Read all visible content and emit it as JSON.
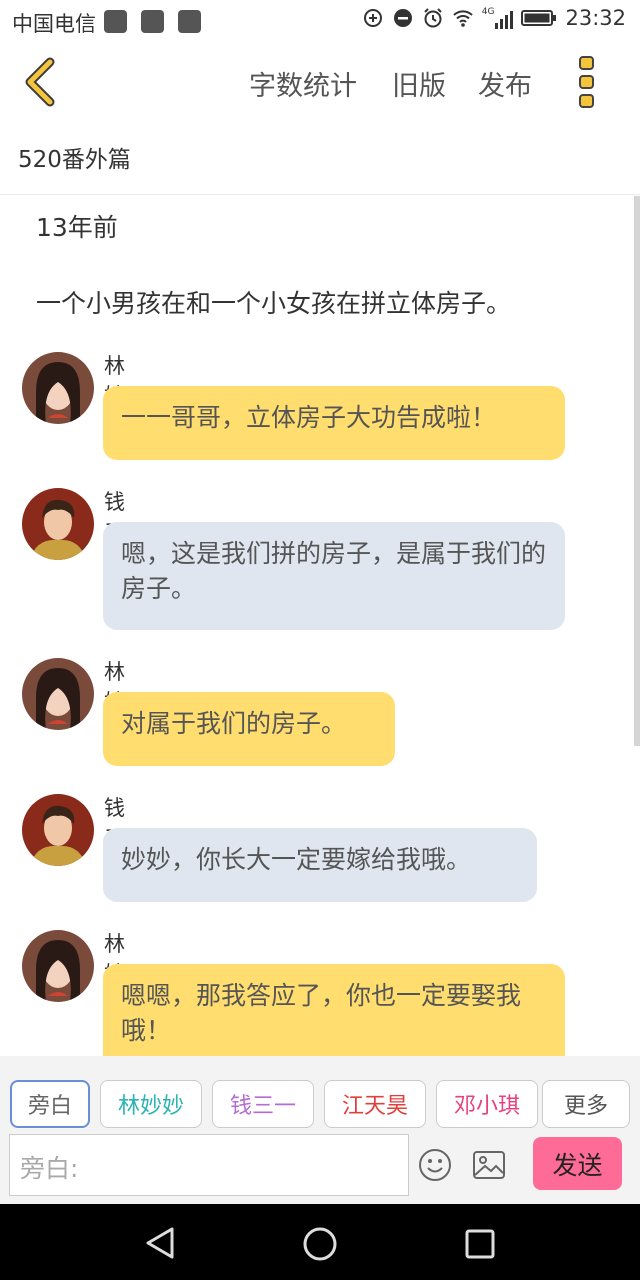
{
  "status_bar": {
    "carrier": "中国电信",
    "network": "4G",
    "time": "23:32"
  },
  "header": {
    "word_count": "字数统计",
    "old_version": "旧版",
    "publish": "发布"
  },
  "document_title": "520番外篇",
  "narration": [
    "13年前",
    "一个小男孩在和一个小女孩在拼立体房子。"
  ],
  "messages": [
    {
      "speaker": "林妙妙",
      "text": "一一哥哥，立体房子大功告成啦！"
    },
    {
      "speaker": "钱三一",
      "text": "嗯，这是我们拼的房子，是属于我们的房子。"
    },
    {
      "speaker": "林妙妙",
      "text": "对属于我们的房子。"
    },
    {
      "speaker": "钱三一",
      "text": "妙妙，你长大一定要嫁给我哦。"
    },
    {
      "speaker": "林妙妙",
      "text": "嗯嗯，那我答应了，你也一定要娶我哦！"
    }
  ],
  "roles": [
    {
      "label": "旁白",
      "color": "#666666"
    },
    {
      "label": "林妙妙",
      "color": "#2bb3b1"
    },
    {
      "label": "钱三一",
      "color": "#b56bd6"
    },
    {
      "label": "江天昊",
      "color": "#e0413c"
    },
    {
      "label": "邓小琪",
      "color": "#e8407e"
    },
    {
      "label": "更多",
      "color": "#555555"
    }
  ],
  "composer": {
    "placeholder": "旁白:",
    "send": "发送"
  },
  "colors": {
    "accent": "#f4c43c",
    "send": "#ff6b97",
    "bubble_female": "#ffdd6e",
    "bubble_male": "#dfe6ef"
  }
}
